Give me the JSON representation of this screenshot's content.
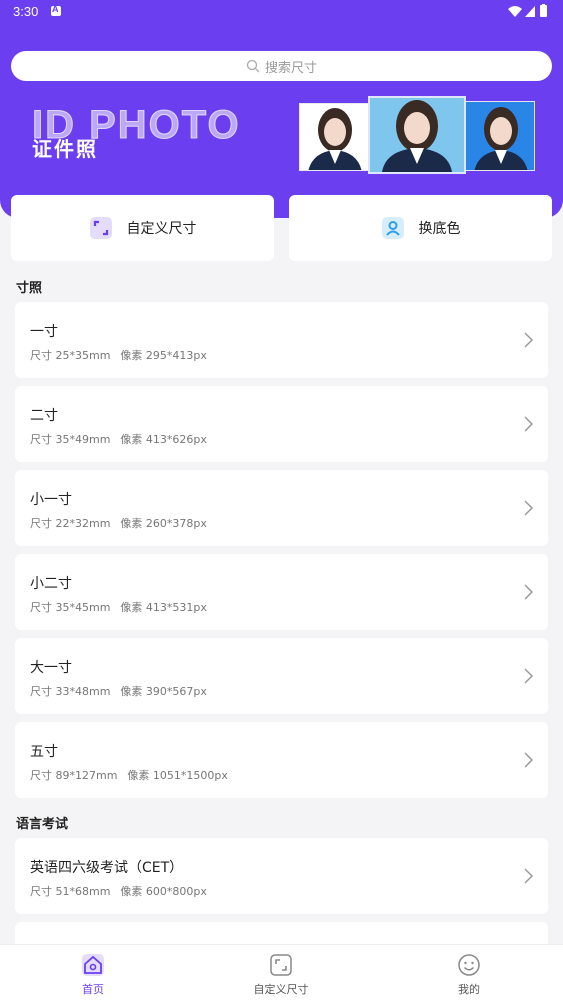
{
  "status_bar": {
    "time": "3:30"
  },
  "search": {
    "placeholder": "搜索尺寸"
  },
  "banner": {
    "title_en": "ID PHOTO",
    "title_cn": "证件照"
  },
  "quick_actions": [
    {
      "label": "自定义尺寸",
      "icon": "crop-frame-icon"
    },
    {
      "label": "换底色",
      "icon": "portrait-icon"
    }
  ],
  "sections": [
    {
      "title": "寸照",
      "items": [
        {
          "title": "一寸",
          "size": "尺寸 25*35mm",
          "pixels": "像素 295*413px"
        },
        {
          "title": "二寸",
          "size": "尺寸 35*49mm",
          "pixels": "像素 413*626px"
        },
        {
          "title": "小一寸",
          "size": "尺寸 22*32mm",
          "pixels": "像素 260*378px"
        },
        {
          "title": "小二寸",
          "size": "尺寸 35*45mm",
          "pixels": "像素 413*531px"
        },
        {
          "title": "大一寸",
          "size": "尺寸 33*48mm",
          "pixels": "像素 390*567px"
        },
        {
          "title": "五寸",
          "size": "尺寸 89*127mm",
          "pixels": "像素 1051*1500px"
        }
      ]
    },
    {
      "title": "语言考试",
      "items": [
        {
          "title": "英语四六级考试（CET）",
          "size": "尺寸 51*68mm",
          "pixels": "像素 600*800px"
        }
      ]
    }
  ],
  "tabbar": [
    {
      "label": "首页",
      "icon": "home-icon",
      "active": true
    },
    {
      "label": "自定义尺寸",
      "icon": "crop-frame-icon",
      "active": false
    },
    {
      "label": "我的",
      "icon": "smile-icon",
      "active": false
    }
  ],
  "colors": {
    "accent": "#6b3ff0",
    "background": "#f4f4f6",
    "card": "#ffffff"
  }
}
